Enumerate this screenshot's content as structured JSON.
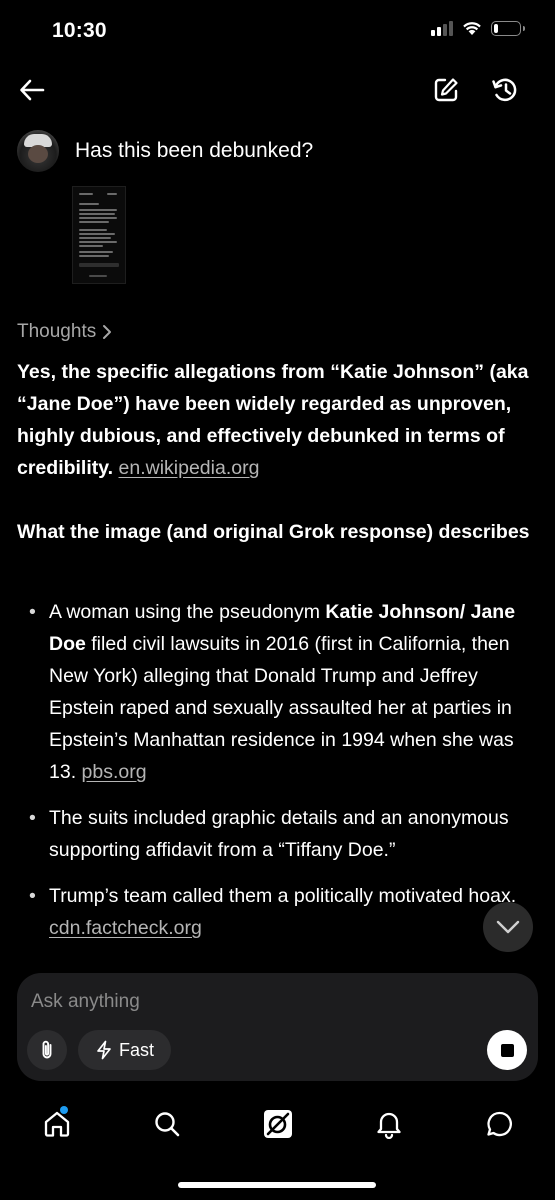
{
  "status_bar": {
    "time": "10:30",
    "battery_level": 0.2
  },
  "nav": {
    "back_icon": "arrow-left-icon",
    "edit_icon": "compose-icon",
    "history_icon": "history-icon"
  },
  "conversation": {
    "user_message": "Has this been debunked?",
    "attachment_icon": "screenshot-thumbnail",
    "thoughts_label": "Thoughts",
    "answer": {
      "text": "Yes, the specific allegations from “Katie Johnson” (aka “Jane Doe”) have been widely regarded as unproven, highly dubious, and effectively debunked in terms of credibility.",
      "source": "en.wikipedia.org"
    },
    "section_heading": "What the image (and original Grok response) describes",
    "bullets": [
      {
        "pre": "A woman using the pseudonym ",
        "bold": "Katie Johnson/ Jane Doe",
        "post": " filed civil lawsuits in 2016 (first in California, then New York) alleging that Donald Trump and Jeffrey Epstein raped and sexually assaulted her at parties in Epstein’s Manhattan residence in 1994 when she was 13.",
        "source": "pbs.org"
      },
      {
        "pre": "The suits included graphic details and an anonymous supporting affidavit from a “Tiffany Doe.”",
        "bold": "",
        "post": "",
        "source": ""
      },
      {
        "pre": "Trump’s team called them a politically motivated hoax.",
        "bold": "",
        "post": "",
        "source": "cdn.factcheck.org"
      }
    ]
  },
  "composer": {
    "placeholder": "Ask anything",
    "mode_label": "Fast",
    "attach_icon": "paperclip-icon",
    "mode_icon": "lightning-icon",
    "stop_icon": "stop-icon"
  },
  "tab_bar": {
    "tabs": [
      {
        "name": "home",
        "icon": "home-icon",
        "has_badge": true
      },
      {
        "name": "search",
        "icon": "search-icon",
        "has_badge": false
      },
      {
        "name": "grok",
        "icon": "grok-icon",
        "has_badge": false
      },
      {
        "name": "notifications",
        "icon": "bell-icon",
        "has_badge": false
      },
      {
        "name": "messages",
        "icon": "chat-bubble-icon",
        "has_badge": false
      }
    ]
  },
  "colors": {
    "background": "#000000",
    "link": "#b5b5b5",
    "muted": "#a7a7a7",
    "composer_bg": "#1c1c1e",
    "badge": "#1d9bf0"
  }
}
